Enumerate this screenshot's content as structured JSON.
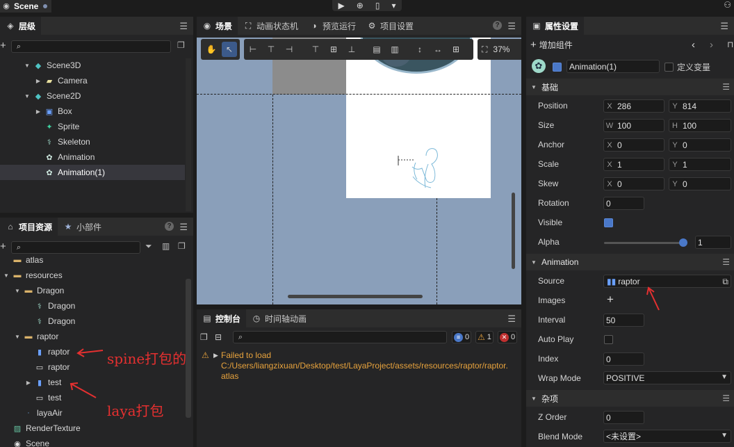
{
  "topbar": {
    "scene_tab": "Scene"
  },
  "hierarchy": {
    "title": "层级",
    "items": [
      {
        "label": "Scene3D",
        "level": 1,
        "icon": "cube-icon",
        "expanded": true
      },
      {
        "label": "Camera",
        "level": 2,
        "icon": "camera-icon",
        "expanded": false
      },
      {
        "label": "Scene2D",
        "level": 1,
        "icon": "cube-icon",
        "expanded": true
      },
      {
        "label": "Box",
        "level": 2,
        "icon": "box-icon",
        "expanded": false
      },
      {
        "label": "Sprite",
        "level": 2,
        "icon": "sprite-icon"
      },
      {
        "label": "Skeleton",
        "level": 2,
        "icon": "skeleton-icon"
      },
      {
        "label": "Animation",
        "level": 2,
        "icon": "film-reel-icon"
      },
      {
        "label": "Animation(1)",
        "level": 2,
        "icon": "film-reel-icon",
        "selected": true
      }
    ]
  },
  "assets": {
    "tab_project": "项目资源",
    "tab_widgets": "小部件",
    "items": [
      {
        "label": "atlas",
        "level": 0,
        "icon": "folder-icon"
      },
      {
        "label": "resources",
        "level": 0,
        "icon": "folder-icon",
        "expanded": true
      },
      {
        "label": "Dragon",
        "level": 1,
        "icon": "folder-icon",
        "expanded": true
      },
      {
        "label": "Dragon",
        "level": 2,
        "icon": "dragon-skeleton-icon"
      },
      {
        "label": "Dragon",
        "level": 2,
        "icon": "dragon-skeleton-icon"
      },
      {
        "label": "raptor",
        "level": 1,
        "icon": "folder-icon",
        "expanded": true
      },
      {
        "label": "raptor",
        "level": 2,
        "icon": "spine-icon"
      },
      {
        "label": "raptor",
        "level": 2,
        "icon": "atlas-icon"
      },
      {
        "label": "test",
        "level": 2,
        "icon": "spine-icon",
        "collapsed": true
      },
      {
        "label": "test",
        "level": 2,
        "icon": "atlas-icon"
      },
      {
        "label": "layaAir",
        "level": 1,
        "icon": "dot-icon"
      },
      {
        "label": "RenderTexture",
        "level": 0,
        "icon": "render-texture-icon"
      },
      {
        "label": "Scene",
        "level": 0,
        "icon": "scene-icon"
      }
    ]
  },
  "scene_tabs": [
    {
      "label": "场景",
      "icon": "scene-icon",
      "active": true
    },
    {
      "label": "动画状态机",
      "icon": "state-machine-icon"
    },
    {
      "label": "预览运行",
      "icon": "preview-icon"
    },
    {
      "label": "项目设置",
      "icon": "settings-icon"
    }
  ],
  "scene_toolbar": {
    "zoom": "37%"
  },
  "console": {
    "tab_console": "控制台",
    "tab_timeline": "时间轴动画",
    "info_count": "0",
    "warn_count": "1",
    "error_count": "0",
    "message_line1": "Failed to load",
    "message_line2": "C:/Users/liangzixuan/Desktop/test/LayaProject/assets/resources/raptor/raptor.",
    "message_line3": "atlas"
  },
  "inspector": {
    "title": "属性设置",
    "add_component": "增加组件",
    "node_name": "Animation(1)",
    "custom_var": "定义变量",
    "section_basic": "基础",
    "position_label": "Position",
    "pos_x": "286",
    "pos_y": "814",
    "size_label": "Size",
    "size_w": "100",
    "size_h": "100",
    "anchor_label": "Anchor",
    "anchor_x": "0",
    "anchor_y": "0",
    "scale_label": "Scale",
    "scale_x": "1",
    "scale_y": "1",
    "skew_label": "Skew",
    "skew_x": "0",
    "skew_y": "0",
    "rotation_label": "Rotation",
    "rotation": "0",
    "visible_label": "Visible",
    "alpha_label": "Alpha",
    "alpha": "1",
    "section_animation": "Animation",
    "source_label": "Source",
    "source": "raptor",
    "images_label": "Images",
    "interval_label": "Interval",
    "interval": "50",
    "autoplay_label": "Auto Play",
    "index_label": "Index",
    "index": "0",
    "wrapmode_label": "Wrap Mode",
    "wrapmode": "POSITIVE",
    "section_misc": "杂项",
    "zorder_label": "Z Order",
    "zorder": "0",
    "blendmode_label": "Blend Mode",
    "blendmode": "<未设置>"
  },
  "annotations": {
    "spine": "spine打包的",
    "laya": "laya打包"
  },
  "colors": {
    "accent": "#4a78c8",
    "warning": "#e8a33d",
    "annotation": "#e53030",
    "scene_bg": "#8a9fba"
  }
}
